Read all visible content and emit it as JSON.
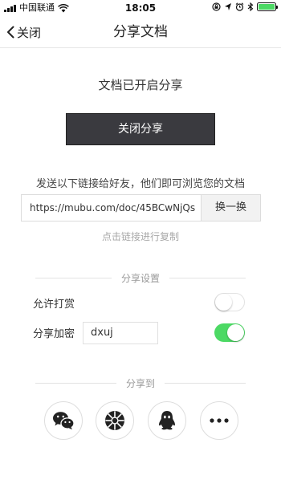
{
  "status_bar": {
    "carrier": "中国联通",
    "time": "18:05",
    "battery_color": "#4cd964"
  },
  "nav": {
    "back_label": "关闭",
    "title": "分享文档"
  },
  "share": {
    "status_text": "文档已开启分享",
    "close_button_label": "关闭分享",
    "send_hint": "发送以下链接给好友，他们即可浏览您的文档",
    "link_value": "https://mubu.com/doc/45BCwNjQs",
    "refresh_label": "换一换",
    "copy_hint": "点击链接进行复制"
  },
  "settings": {
    "header": "分享设置",
    "tip_label": "允许打赏",
    "tip_enabled": false,
    "password_label": "分享加密",
    "password_value": "dxuj",
    "password_enabled": true,
    "toggle_on_color": "#4cd964"
  },
  "share_to": {
    "header": "分享到",
    "targets": [
      {
        "icon": "wechat-icon"
      },
      {
        "icon": "moments-icon"
      },
      {
        "icon": "qq-icon"
      },
      {
        "icon": "more-icon"
      }
    ]
  }
}
